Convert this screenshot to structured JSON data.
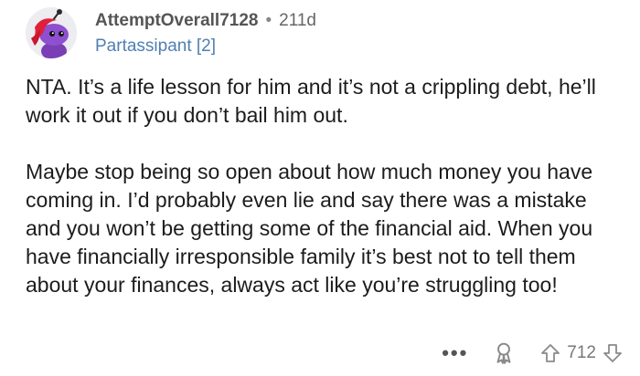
{
  "comment": {
    "username": "AttemptOverall7128",
    "separator": "•",
    "age": "211d",
    "flair": "Partassipant [2]",
    "paragraphs": [
      "NTA. It’s a life lesson for him and it’s not a crippling debt, he’ll work it out if you don’t bail him out.",
      "Maybe stop being so open about how much money you have coming in. I’d probably even lie and say there was a mistake and you won’t be getting some of the financial aid. When you have financially irresponsible family it’s best not to tell them about your finances, always act like you’re struggling too!"
    ],
    "more_label": "•••",
    "vote_count": "712"
  },
  "icons": {
    "avatar": "snoo-avatar",
    "award": "award-icon",
    "upvote": "upvote-arrow-icon",
    "downvote": "downvote-arrow-icon"
  },
  "colors": {
    "flair": "#4f7fb3",
    "username": "#555555",
    "text": "#1c1c1c",
    "icons": "#8a8a8a"
  }
}
